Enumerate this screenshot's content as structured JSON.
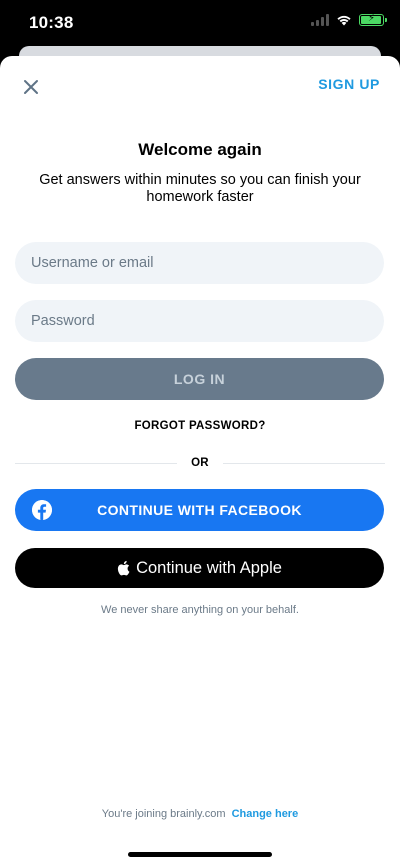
{
  "status_bar": {
    "time": "10:38",
    "icons": [
      "signal-icon",
      "wifi-icon",
      "battery-charging-icon"
    ],
    "battery_level": 1.0
  },
  "header": {
    "close_icon": "close-icon",
    "signup_label": "SIGN UP"
  },
  "welcome": {
    "title": "Welcome again",
    "subtitle": "Get answers within minutes so you can finish your homework faster"
  },
  "form": {
    "username_placeholder": "Username or email",
    "username_value": "",
    "password_placeholder": "Password",
    "password_value": "",
    "login_label": "LOG IN",
    "forgot_label": "FORGOT PASSWORD?"
  },
  "divider": {
    "or_label": "OR"
  },
  "social": {
    "facebook_label": "CONTINUE WITH FACEBOOK",
    "facebook_icon": "facebook-icon",
    "apple_label": "Continue with Apple",
    "apple_icon": "apple-icon",
    "disclaimer": "We never share anything on your behalf."
  },
  "footer": {
    "joining_text": "You're joining brainly.com",
    "change_label": "Change here"
  },
  "colors": {
    "accent": "#1f9ae0",
    "facebook": "#1877f2",
    "login_disabled": "#687a8c",
    "input_bg": "#f0f4f8"
  }
}
